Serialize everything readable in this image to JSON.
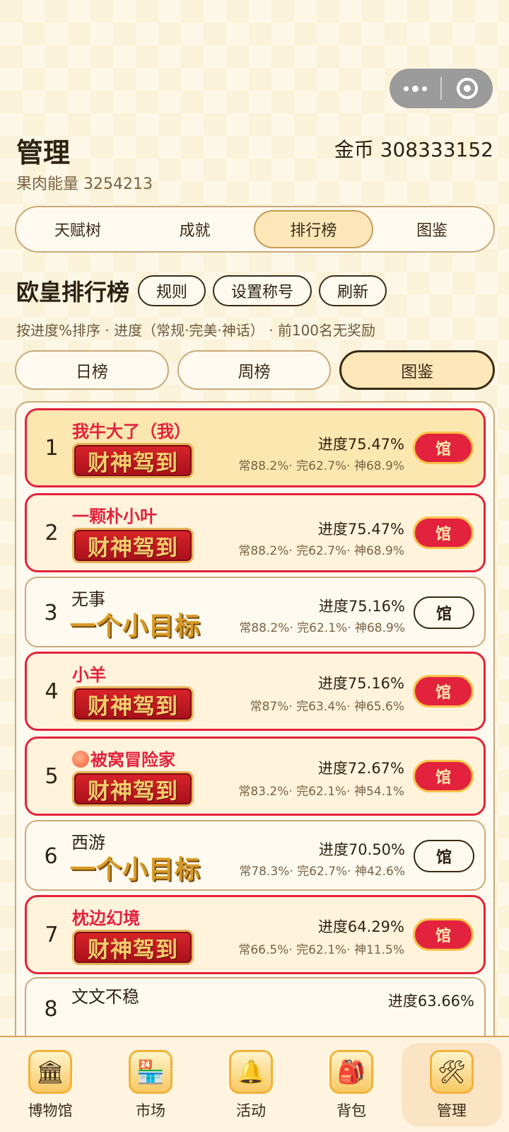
{
  "capsule": {
    "more_icon": "more-dots-icon",
    "close_icon": "target-circle-icon"
  },
  "header": {
    "title": "管理",
    "coins": "金币 308333152",
    "energy": "果肉能量 3254213"
  },
  "tabs": [
    {
      "label": "天赋树",
      "active": false
    },
    {
      "label": "成就",
      "active": false
    },
    {
      "label": "排行榜",
      "active": true
    },
    {
      "label": "图鉴",
      "active": false
    }
  ],
  "leaderboard": {
    "title": "欧皇排行榜",
    "rules_label": "规则",
    "set_title_label": "设置称号",
    "refresh_label": "刷新",
    "hint": "按进度%排序 · 进度（常规·完美·神话） · 前100名无奖励"
  },
  "periods": [
    {
      "label": "日榜",
      "active": false
    },
    {
      "label": "周榜",
      "active": false
    },
    {
      "label": "图鉴",
      "active": true
    }
  ],
  "rows": [
    {
      "rank": "1",
      "name": "我牛大了（我）",
      "badge": "财神驾到",
      "progress": "进度75.47%",
      "detail": "常88.2%· 完62.7%· 神68.9%",
      "button": "馆"
    },
    {
      "rank": "2",
      "name": "一颗朴小叶",
      "badge": "财神驾到",
      "progress": "进度75.47%",
      "detail": "常88.2%· 完62.7%· 神68.9%",
      "button": "馆"
    },
    {
      "rank": "3",
      "name": "无事",
      "badge": "一个小目标",
      "progress": "进度75.16%",
      "detail": "常88.2%· 完62.1%· 神68.9%",
      "button": "馆"
    },
    {
      "rank": "4",
      "name": "小羊",
      "badge": "财神驾到",
      "progress": "进度75.16%",
      "detail": "常87%· 完63.4%· 神65.6%",
      "button": "馆"
    },
    {
      "rank": "5",
      "name": "被窝冒险家",
      "badge": "财神驾到",
      "progress": "进度72.67%",
      "detail": "常83.2%· 完62.1%· 神54.1%",
      "button": "馆"
    },
    {
      "rank": "6",
      "name": "西游",
      "badge": "一个小目标",
      "progress": "进度70.50%",
      "detail": "常78.3%· 完62.7%· 神42.6%",
      "button": "馆"
    },
    {
      "rank": "7",
      "name": "枕边幻境",
      "badge": "财神驾到",
      "progress": "进度64.29%",
      "detail": "常66.5%· 完62.1%· 神11.5%",
      "button": "馆"
    },
    {
      "rank": "8",
      "name": "文文不稳",
      "progress": "进度63.66%"
    }
  ],
  "bottom_nav": [
    {
      "label": "博物馆",
      "icon": "museum-icon",
      "glyph": "🏛"
    },
    {
      "label": "市场",
      "icon": "market-stall-icon",
      "glyph": "🏪"
    },
    {
      "label": "活动",
      "icon": "party-bell-icon",
      "glyph": "🔔"
    },
    {
      "label": "背包",
      "icon": "backpack-icon",
      "glyph": "🎒"
    },
    {
      "label": "管理",
      "icon": "clipboard-tools-icon",
      "glyph": "🛠",
      "active": true
    }
  ],
  "colors": {
    "accent_red": "#e3223d",
    "active_tab": "#fde7b8",
    "background": "#fbf3d9"
  }
}
